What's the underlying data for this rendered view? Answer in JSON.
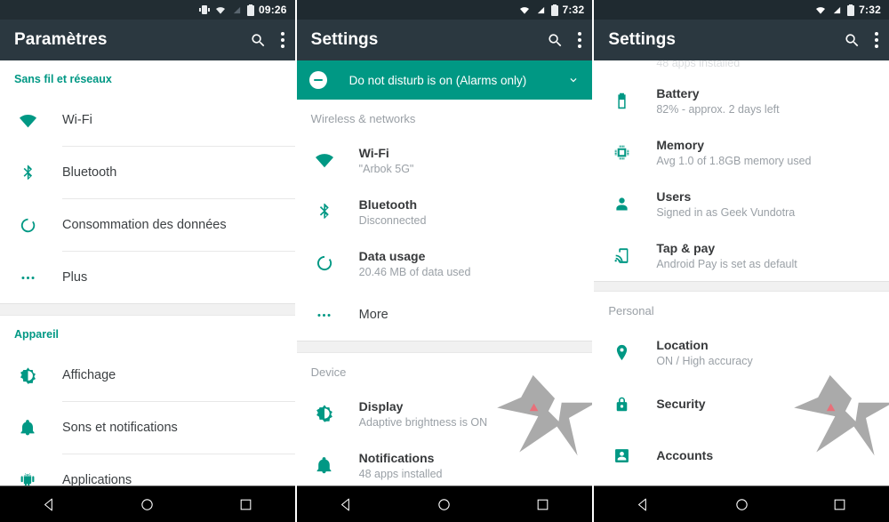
{
  "phone1": {
    "status": {
      "time": "09:26",
      "icons": [
        "vibrate-icon",
        "wifi-icon",
        "signal-icon",
        "battery-icon"
      ]
    },
    "appbar": {
      "title": "Paramètres",
      "search_icon": "search-icon",
      "overflow_icon": "more-vert-icon"
    },
    "sections": [
      {
        "header": "Sans fil et réseaux",
        "header_color": "#009884",
        "items": [
          {
            "icon": "wifi-icon",
            "title": "Wi-Fi"
          },
          {
            "icon": "bluetooth-icon",
            "title": "Bluetooth"
          },
          {
            "icon": "data-usage-icon",
            "title": "Consommation des données"
          },
          {
            "icon": "more-horiz-icon",
            "title": "Plus"
          }
        ]
      },
      {
        "header": "Appareil",
        "header_color": "#009884",
        "items": [
          {
            "icon": "brightness-icon",
            "title": "Affichage"
          },
          {
            "icon": "bell-icon",
            "title": "Sons et notifications"
          },
          {
            "icon": "android-icon",
            "title": "Applications"
          }
        ]
      }
    ],
    "navbar": {
      "back": "back-icon",
      "home": "home-icon",
      "recents": "recents-icon"
    }
  },
  "phone2": {
    "status": {
      "time": "7:32",
      "icons": [
        "wifi-icon",
        "signal-icon",
        "battery-icon"
      ]
    },
    "appbar": {
      "title": "Settings",
      "search_icon": "search-icon",
      "overflow_icon": "more-vert-icon"
    },
    "banner": {
      "icon": "do-not-disturb-icon",
      "text": "Do not disturb is on (Alarms only)",
      "chevron": "chevron-down-icon"
    },
    "sections": [
      {
        "header": "Wireless & networks",
        "header_color": "#9aa0a6",
        "items": [
          {
            "icon": "wifi-icon",
            "title": "Wi-Fi",
            "subtitle": "\"Arbok 5G\""
          },
          {
            "icon": "bluetooth-icon",
            "title": "Bluetooth",
            "subtitle": "Disconnected"
          },
          {
            "icon": "data-usage-icon",
            "title": "Data usage",
            "subtitle": "20.46 MB of data used"
          },
          {
            "icon": "more-horiz-icon",
            "title": "More",
            "subtitle": ""
          }
        ]
      },
      {
        "header": "Device",
        "header_color": "#9aa0a6",
        "items": [
          {
            "icon": "brightness-icon",
            "title": "Display",
            "subtitle": "Adaptive brightness is ON"
          },
          {
            "icon": "bell-icon",
            "title": "Notifications",
            "subtitle": "48 apps installed"
          }
        ]
      }
    ],
    "navbar": {
      "back": "back-icon",
      "home": "home-icon",
      "recents": "recents-icon"
    }
  },
  "phone3": {
    "status": {
      "time": "7:32",
      "icons": [
        "wifi-icon",
        "signal-icon",
        "battery-icon"
      ]
    },
    "appbar": {
      "title": "Settings",
      "search_icon": "search-icon",
      "overflow_icon": "more-vert-icon"
    },
    "scrolled_partial_text": "48 apps installed",
    "sections": [
      {
        "header": "",
        "items": [
          {
            "icon": "battery-icon",
            "title": "Battery",
            "subtitle": "82% - approx. 2 days left"
          },
          {
            "icon": "memory-icon",
            "title": "Memory",
            "subtitle": "Avg 1.0 of 1.8GB memory used"
          },
          {
            "icon": "user-icon",
            "title": "Users",
            "subtitle": "Signed in as Geek Vundotra"
          },
          {
            "icon": "tap-and-pay-icon",
            "title": "Tap & pay",
            "subtitle": "Android Pay is set as default"
          }
        ]
      },
      {
        "header": "Personal",
        "header_color": "#9aa0a6",
        "items": [
          {
            "icon": "location-pin-icon",
            "title": "Location",
            "subtitle": "ON / High accuracy"
          },
          {
            "icon": "lock-icon",
            "title": "Security",
            "subtitle": ""
          },
          {
            "icon": "account-box-icon",
            "title": "Accounts",
            "subtitle": ""
          }
        ]
      }
    ],
    "navbar": {
      "back": "back-icon",
      "home": "home-icon",
      "recents": "recents-icon"
    }
  },
  "theme": {
    "accent_teal": "#009884",
    "appbar_bg": "#2b3840",
    "statusbar_bg": "#222d33",
    "subtitle_grey": "#9aa0a6",
    "navbar_bg": "#000000",
    "watermark_grey": "#aaaaaa",
    "watermark_red": "#e8707a"
  }
}
